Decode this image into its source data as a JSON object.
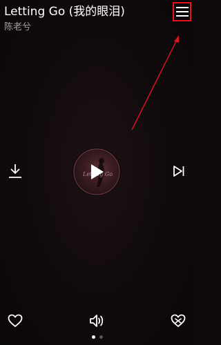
{
  "song": {
    "title": "Letting Go (我的眼泪)",
    "artist": "陈老兮"
  },
  "disc": {
    "cover_text": "Letting Go"
  },
  "pager": {
    "total": 2,
    "active_index": 0
  },
  "colors": {
    "background": "#0f0b0c",
    "accent_red": "#e8141d",
    "artist_gray": "#a49fa1"
  },
  "icons": {
    "menu": "menu-icon",
    "download": "download-icon",
    "play": "play-icon",
    "next": "skip-next-icon",
    "like": "heart-icon",
    "volume": "volume-icon",
    "dislike": "broken-heart-icon"
  }
}
